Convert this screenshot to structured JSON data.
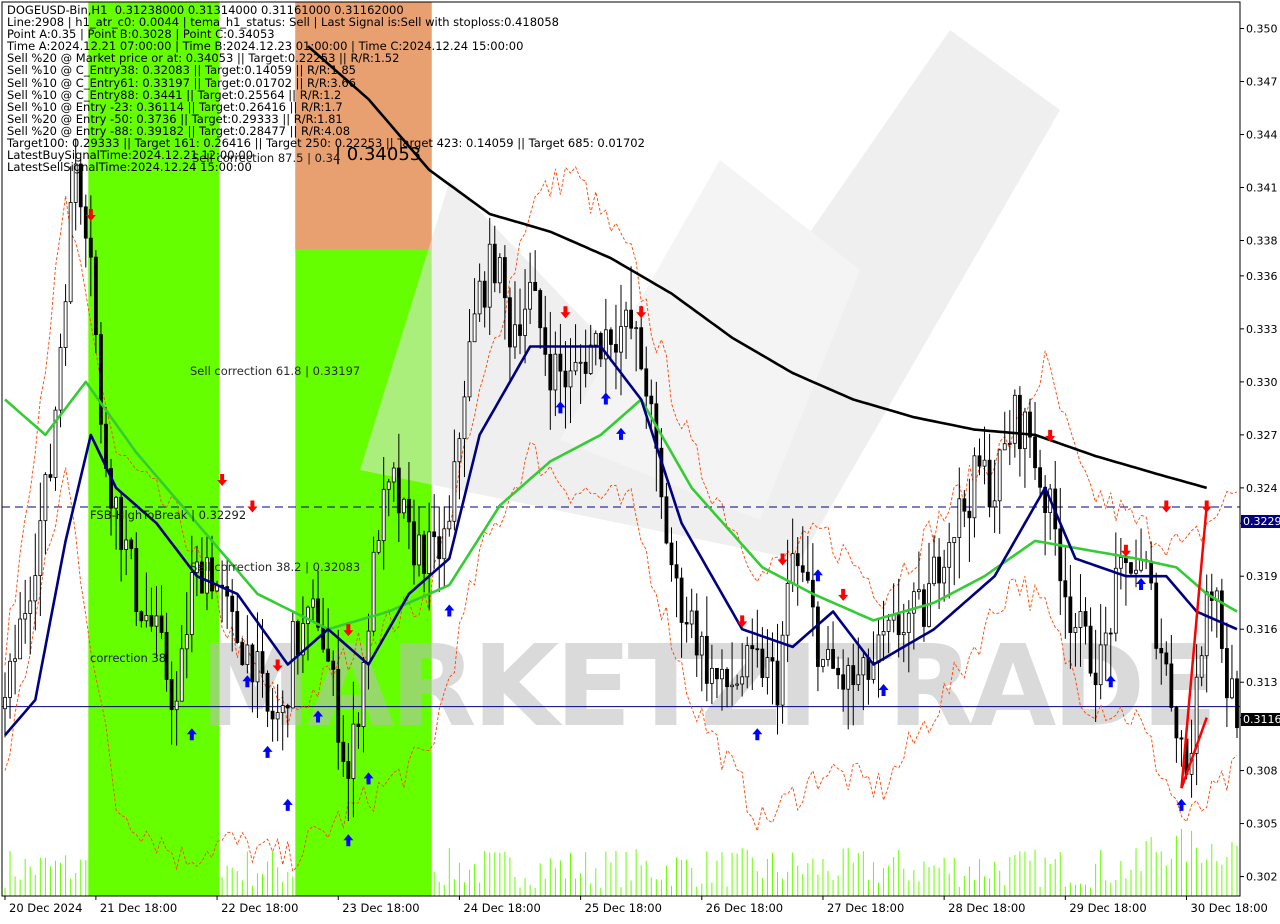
{
  "info": {
    "lines": [
      "DOGEUSD-Bin,H1  0.31238000 0.31314000 0.31161000 0.31162000",
      "Line:2908 | h1_atr_c0: 0.0044 | tema_h1_status: Sell | Last Signal is:Sell with stoploss:0.418058",
      "Point A:0.35 | Point B:0.3028 | Point C:0.34053",
      "Time A:2024.12.21 07:00:00 | Time B:2024.12.23 01:00:00 | Time C:2024.12.24 15:00:00",
      "Sell %20 @ Market price or at: 0.34053 || Target:0.22253 || R/R:1.52",
      "Sell %10 @ C_Entry38: 0.32083 || Target:0.14059 || R/R:1.85",
      "Sell %10 @ C_Entry61: 0.33197 || Target:0.01702 || R/R:3.66",
      "Sell %10 @ C_Entry88: 0.3441 || Target:0.25564 || R/R:1.2",
      "Sell %10 @ Entry -23: 0.36114 || Target:0.26416 || R/R:1.7",
      "Sell %20 @ Entry -50: 0.3736 || Target:0.29333 || R/R:1.81",
      "Sell %20 @ Entry -88: 0.39182 || Target:0.28477 || R/R:4.08",
      "Target100: 0.29333 || Target 161: 0.26416 || Target 250: 0.22253 || Target 423: 0.14059 || Target 685: 0.01702",
      "LatestBuySignalTime:2024.12.21 12:00:00",
      "LatestSellSignalTime:2024.12.24 15:00:00"
    ]
  },
  "annotations": {
    "point_c_label": "| 0.34053",
    "sell_correction_87": "Sell correction 87.5 | 0.34",
    "sell_correction_61": "Sell correction 61.8 | 0.33197",
    "sell_correction_38": "Sell correction 38.2 | 0.32083",
    "fsb_high_to_break": "FSB-HighToBreak | 0.32292",
    "correction_38": "correction 38"
  },
  "watermark": {
    "text": "MARKETZITRADE",
    "color": "#bdbdbd"
  },
  "price_labels": {
    "upper": "0.3229",
    "lower": "0.3116"
  },
  "colors": {
    "background": "#ffffff",
    "green_zone": "#66ff00",
    "orange_zone": "#e8a070",
    "candle": "#000000",
    "tema_line": "#000080",
    "ma_green": "#33cc33",
    "ma_black": "#000000",
    "envelope": "#ff4500",
    "buy_arrow": "#0000ff",
    "sell_arrow": "#ff0000",
    "hline_blue": "#000080",
    "volume": "#66ff00"
  },
  "chart_data": {
    "type": "candlestick",
    "symbol": "DOGEUSD-Bin",
    "timeframe": "H1",
    "ylim": [
      0.3009,
      0.3515
    ],
    "y_ticks": [
      "0.350",
      "0.347",
      "0.344",
      "0.341",
      "0.338",
      "0.336",
      "0.333",
      "0.330",
      "0.327",
      "0.324",
      "0.322",
      "0.319",
      "0.316",
      "0.313",
      "0.311",
      "0.308",
      "0.305",
      "0.302"
    ],
    "y_tick_values": [
      0.35,
      0.347,
      0.344,
      0.341,
      0.338,
      0.336,
      0.333,
      0.33,
      0.327,
      0.324,
      0.322,
      0.319,
      0.316,
      0.313,
      0.311,
      0.308,
      0.305,
      0.302
    ],
    "x_tick_labels": [
      "20 Dec 2024",
      "21 Dec 18:00",
      "22 Dec 18:00",
      "23 Dec 18:00",
      "24 Dec 18:00",
      "25 Dec 18:00",
      "26 Dec 18:00",
      "27 Dec 18:00",
      "28 Dec 18:00",
      "29 Dec 18:00",
      "30 Dec 18:00"
    ],
    "x_tick_index": [
      0,
      18,
      42,
      66,
      90,
      114,
      138,
      162,
      186,
      210,
      234
    ],
    "bar_count": 245,
    "anchors": [
      [
        0,
        0.3115
      ],
      [
        6,
        0.3205
      ],
      [
        9,
        0.325
      ],
      [
        12,
        0.336
      ],
      [
        14,
        0.3425
      ],
      [
        17,
        0.338
      ],
      [
        19,
        0.327
      ],
      [
        22,
        0.323
      ],
      [
        26,
        0.318
      ],
      [
        30,
        0.3155
      ],
      [
        34,
        0.3115
      ],
      [
        37,
        0.3185
      ],
      [
        40,
        0.32
      ],
      [
        45,
        0.316
      ],
      [
        49,
        0.3145
      ],
      [
        52,
        0.311
      ],
      [
        55,
        0.311
      ],
      [
        57,
        0.315
      ],
      [
        62,
        0.317
      ],
      [
        66,
        0.311
      ],
      [
        68,
        0.3075
      ],
      [
        71,
        0.314
      ],
      [
        74,
        0.322
      ],
      [
        77,
        0.324
      ],
      [
        80,
        0.321
      ],
      [
        85,
        0.32
      ],
      [
        88,
        0.3215
      ],
      [
        91,
        0.33
      ],
      [
        94,
        0.335
      ],
      [
        97,
        0.337
      ],
      [
        100,
        0.333
      ],
      [
        104,
        0.335
      ],
      [
        108,
        0.331
      ],
      [
        112,
        0.33
      ],
      [
        116,
        0.332
      ],
      [
        120,
        0.333
      ],
      [
        124,
        0.333
      ],
      [
        127,
        0.33
      ],
      [
        130,
        0.323
      ],
      [
        133,
        0.318
      ],
      [
        136,
        0.3165
      ],
      [
        139,
        0.314
      ],
      [
        142,
        0.3125
      ],
      [
        146,
        0.3135
      ],
      [
        150,
        0.314
      ],
      [
        153,
        0.313
      ],
      [
        156,
        0.32
      ],
      [
        159,
        0.318
      ],
      [
        162,
        0.314
      ],
      [
        166,
        0.313
      ],
      [
        170,
        0.313
      ],
      [
        174,
        0.315
      ],
      [
        178,
        0.3165
      ],
      [
        182,
        0.317
      ],
      [
        186,
        0.321
      ],
      [
        190,
        0.323
      ],
      [
        193,
        0.325
      ],
      [
        196,
        0.324
      ],
      [
        200,
        0.328
      ],
      [
        203,
        0.327
      ],
      [
        205,
        0.3245
      ],
      [
        208,
        0.3215
      ],
      [
        211,
        0.317
      ],
      [
        214,
        0.315
      ],
      [
        217,
        0.314
      ],
      [
        220,
        0.318
      ],
      [
        223,
        0.32
      ],
      [
        226,
        0.319
      ],
      [
        229,
        0.315
      ],
      [
        232,
        0.311
      ],
      [
        234,
        0.308
      ],
      [
        236,
        0.312
      ],
      [
        238,
        0.319
      ],
      [
        240,
        0.318
      ],
      [
        242,
        0.313
      ],
      [
        244,
        0.3116
      ]
    ],
    "envelope_hi_anchors": [
      [
        0,
        0.314
      ],
      [
        12,
        0.34
      ],
      [
        22,
        0.326
      ],
      [
        35,
        0.322
      ],
      [
        44,
        0.316
      ],
      [
        56,
        0.311
      ],
      [
        70,
        0.315
      ],
      [
        84,
        0.318
      ],
      [
        94,
        0.329
      ],
      [
        104,
        0.34
      ],
      [
        112,
        0.342
      ],
      [
        124,
        0.337
      ],
      [
        136,
        0.326
      ],
      [
        150,
        0.319
      ],
      [
        162,
        0.3215
      ],
      [
        174,
        0.318
      ],
      [
        190,
        0.324
      ],
      [
        200,
        0.327
      ],
      [
        206,
        0.331
      ],
      [
        214,
        0.324
      ],
      [
        224,
        0.322
      ],
      [
        234,
        0.3205
      ],
      [
        244,
        0.324
      ]
    ],
    "envelope_lo_anchors": [
      [
        0,
        0.308
      ],
      [
        12,
        0.325
      ],
      [
        22,
        0.306
      ],
      [
        35,
        0.303
      ],
      [
        44,
        0.304
      ],
      [
        56,
        0.303
      ],
      [
        70,
        0.306
      ],
      [
        84,
        0.309
      ],
      [
        94,
        0.32
      ],
      [
        104,
        0.326
      ],
      [
        112,
        0.324
      ],
      [
        124,
        0.323
      ],
      [
        136,
        0.312
      ],
      [
        150,
        0.305
      ],
      [
        162,
        0.308
      ],
      [
        174,
        0.307
      ],
      [
        190,
        0.314
      ],
      [
        200,
        0.319
      ],
      [
        206,
        0.317
      ],
      [
        214,
        0.312
      ],
      [
        224,
        0.311
      ],
      [
        234,
        0.305
      ],
      [
        244,
        0.308
      ]
    ],
    "ma_black_anchors": [
      [
        60,
        0.349
      ],
      [
        72,
        0.346
      ],
      [
        84,
        0.342
      ],
      [
        96,
        0.3395
      ],
      [
        108,
        0.3385
      ],
      [
        120,
        0.337
      ],
      [
        132,
        0.335
      ],
      [
        144,
        0.3325
      ],
      [
        156,
        0.3305
      ],
      [
        168,
        0.329
      ],
      [
        180,
        0.328
      ],
      [
        192,
        0.3273
      ],
      [
        204,
        0.327
      ],
      [
        216,
        0.3258
      ],
      [
        228,
        0.3248
      ],
      [
        238,
        0.324
      ]
    ],
    "ma_green_anchors": [
      [
        0,
        0.329
      ],
      [
        8,
        0.327
      ],
      [
        16,
        0.33
      ],
      [
        26,
        0.326
      ],
      [
        38,
        0.322
      ],
      [
        50,
        0.318
      ],
      [
        64,
        0.316
      ],
      [
        76,
        0.317
      ],
      [
        88,
        0.3185
      ],
      [
        98,
        0.323
      ],
      [
        108,
        0.3255
      ],
      [
        118,
        0.327
      ],
      [
        126,
        0.329
      ],
      [
        136,
        0.324
      ],
      [
        150,
        0.3195
      ],
      [
        160,
        0.318
      ],
      [
        172,
        0.3165
      ],
      [
        184,
        0.3175
      ],
      [
        194,
        0.319
      ],
      [
        204,
        0.321
      ],
      [
        214,
        0.3205
      ],
      [
        224,
        0.32
      ],
      [
        232,
        0.3195
      ],
      [
        238,
        0.318
      ],
      [
        244,
        0.317
      ]
    ],
    "tema_anchors": [
      [
        0,
        0.31
      ],
      [
        6,
        0.312
      ],
      [
        12,
        0.321
      ],
      [
        17,
        0.327
      ],
      [
        22,
        0.324
      ],
      [
        30,
        0.322
      ],
      [
        38,
        0.319
      ],
      [
        46,
        0.318
      ],
      [
        56,
        0.314
      ],
      [
        64,
        0.316
      ],
      [
        72,
        0.314
      ],
      [
        80,
        0.318
      ],
      [
        88,
        0.32
      ],
      [
        94,
        0.327
      ],
      [
        104,
        0.332
      ],
      [
        112,
        0.332
      ],
      [
        118,
        0.332
      ],
      [
        126,
        0.329
      ],
      [
        134,
        0.322
      ],
      [
        146,
        0.316
      ],
      [
        156,
        0.315
      ],
      [
        164,
        0.317
      ],
      [
        172,
        0.314
      ],
      [
        184,
        0.316
      ],
      [
        196,
        0.319
      ],
      [
        206,
        0.324
      ],
      [
        212,
        0.32
      ],
      [
        222,
        0.319
      ],
      [
        230,
        0.319
      ],
      [
        236,
        0.317
      ],
      [
        244,
        0.316
      ]
    ],
    "zones": [
      {
        "from": 17,
        "to": 42,
        "color": "green"
      },
      {
        "from": 58,
        "to": 84,
        "color": "green"
      },
      {
        "from": 58,
        "to": 84,
        "color": "orange",
        "top_price": 0.3375
      }
    ],
    "hlines": [
      {
        "price": 0.32292,
        "style": "dashed",
        "color": "#000080"
      },
      {
        "price": 0.31162,
        "style": "solid",
        "color": "#000080"
      }
    ],
    "buy_arrows": [
      [
        37,
        0.31
      ],
      [
        48,
        0.313
      ],
      [
        52,
        0.309
      ],
      [
        56,
        0.306
      ],
      [
        62,
        0.311
      ],
      [
        68,
        0.304
      ],
      [
        72,
        0.3075
      ],
      [
        88,
        0.317
      ],
      [
        110,
        0.3285
      ],
      [
        119,
        0.329
      ],
      [
        122,
        0.327
      ],
      [
        149,
        0.31
      ],
      [
        161,
        0.319
      ],
      [
        174,
        0.3125
      ],
      [
        219,
        0.313
      ],
      [
        225,
        0.3185
      ],
      [
        233,
        0.306
      ]
    ],
    "sell_arrows": [
      [
        17,
        0.3395
      ],
      [
        43,
        0.3245
      ],
      [
        49,
        0.323
      ],
      [
        54,
        0.314
      ],
      [
        68,
        0.316
      ],
      [
        111,
        0.334
      ],
      [
        126,
        0.334
      ],
      [
        146,
        0.3165
      ],
      [
        154,
        0.32
      ],
      [
        166,
        0.318
      ],
      [
        207,
        0.327
      ],
      [
        222,
        0.3205
      ],
      [
        230,
        0.323
      ],
      [
        238,
        0.323
      ]
    ],
    "point_c": {
      "index": 77,
      "price": 0.34053
    },
    "red_trendlines": [
      [
        [
          233,
          0.307
        ],
        [
          238,
          0.323
        ]
      ],
      [
        [
          233,
          0.307
        ],
        [
          238,
          0.311
        ]
      ]
    ]
  }
}
